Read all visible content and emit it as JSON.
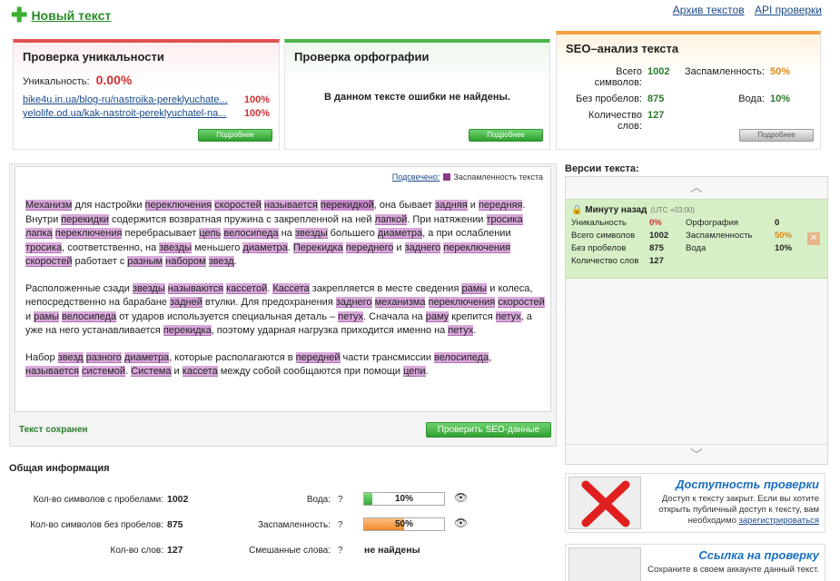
{
  "header": {
    "new_text": "Новый текст",
    "links": [
      "Архив текстов",
      "API проверки"
    ]
  },
  "uniqueness": {
    "title": "Проверка уникальности",
    "label": "Уникальность:",
    "value": "0.00%",
    "sources": [
      {
        "url": "bike4u.in.ua/blog-ru/nastroika-pereklyuchate...",
        "pct": "100%"
      },
      {
        "url": "yelolife.od.ua/kak-nastroit-pereklyuchatel-na...",
        "pct": "100%"
      }
    ],
    "more": "Подробнее"
  },
  "orthography": {
    "title": "Проверка орфографии",
    "message": "В данном тексте ошибки не найдены.",
    "more": "Подробнее"
  },
  "seo": {
    "title": "SEO–анализ текста",
    "chars_label": "Всего символов:",
    "chars": "1002",
    "spam_label": "Заспамленность:",
    "spam": "50%",
    "nospace_label": "Без пробелов:",
    "nospace": "875",
    "water_label": "Вода:",
    "water": "10%",
    "words_label": "Количество слов:",
    "words": "127",
    "more": "Подробнее"
  },
  "editor": {
    "legend_link": "Подсвечено:",
    "legend_text": "Заспамленность текста",
    "status": "Текст сохранен",
    "check_button": "Проверить SEO-данные"
  },
  "versions": {
    "title": "Версии текста:",
    "item": {
      "time": "Минуту назад",
      "tz": "(UTC +03:00)",
      "uniq_label": "Уникальность",
      "uniq": "0%",
      "orth_label": "Орфография",
      "orth": "0",
      "chars_label": "Всего символов",
      "chars": "1002",
      "spam_label": "Заспамленность",
      "spam": "50%",
      "nospace_label": "Без пробелов",
      "nospace": "875",
      "water_label": "Вода",
      "water": "10%",
      "words_label": "Количество слов",
      "words": "127"
    }
  },
  "general": {
    "title": "Общая информация",
    "chars_label": "Кол-во символов с пробелами:",
    "chars": "1002",
    "nospace_label": "Кол-во символов без пробелов:",
    "nospace": "875",
    "words_label": "Кол-во слов:",
    "words": "127",
    "water_label": "Вода:",
    "water": "10%",
    "water_level": 0.1,
    "spam_label": "Заспамленность:",
    "spam": "50%",
    "spam_level": 0.5,
    "mixed_label": "Смешанные слова:",
    "mixed": "не найдены",
    "q": "?"
  },
  "promo1": {
    "title": "Доступность проверки",
    "text": "Доступ к тексту закрыт. Если вы хотите открыть публичный доступ к тексту, вам необходимо",
    "link": "зарегистрироваться"
  },
  "promo2": {
    "title": "Ссылка на проверку",
    "text": "Сохраните в своем аккаунте данный текст."
  },
  "colors": {
    "green": "#49b549",
    "red": "#e25050",
    "orange": "#f0a23c",
    "highlight": "#d8a8da"
  }
}
